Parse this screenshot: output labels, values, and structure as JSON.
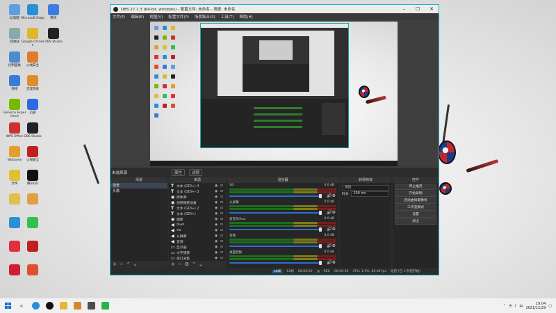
{
  "desktop": {
    "icons": [
      {
        "label": "此电脑",
        "color": "#5aa0e0"
      },
      {
        "label": "Microsoft Edge",
        "color": "#2b8fd6"
      },
      {
        "label": "腾讯",
        "color": "#3e7be0"
      },
      {
        "label": "回收站",
        "color": "#8aa"
      },
      {
        "label": "Google Chrome",
        "color": "#e0b62b"
      },
      {
        "label": "OBS Studio",
        "color": "#222"
      },
      {
        "label": "控制面板",
        "color": "#4a8ed0"
      },
      {
        "label": "火绒安全",
        "color": "#e07b2b"
      },
      {
        "label": "",
        "color": "#fff"
      },
      {
        "label": "网络",
        "color": "#3a7bd5"
      },
      {
        "label": "百度网盘",
        "color": "#e08c2b"
      },
      {
        "label": "",
        "color": "#fff"
      },
      {
        "label": "GeForce Experience",
        "color": "#76b900"
      },
      {
        "label": "迅雷",
        "color": "#2b6be0"
      },
      {
        "label": "",
        "color": "#fff"
      },
      {
        "label": "WPS Office",
        "color": "#d03030"
      },
      {
        "label": "OBS Studio",
        "color": "#222"
      },
      {
        "label": "",
        "color": "#fff"
      },
      {
        "label": "WeGame",
        "color": "#e0a02b"
      },
      {
        "label": "火绒安全",
        "color": "#c02020"
      },
      {
        "label": "",
        "color": "#fff"
      },
      {
        "label": "文件",
        "color": "#e0c030"
      },
      {
        "label": "腾讯QQ",
        "color": "#111"
      },
      {
        "label": "",
        "color": "#fff"
      },
      {
        "label": "",
        "color": "#e0c04a"
      },
      {
        "label": "",
        "color": "#e0a040"
      },
      {
        "label": "",
        "color": "#fff"
      },
      {
        "label": "",
        "color": "#2b8fd6"
      },
      {
        "label": "",
        "color": "#32c050"
      },
      {
        "label": "",
        "color": "#fff"
      },
      {
        "label": "",
        "color": "#e03040"
      },
      {
        "label": "",
        "color": "#c02020"
      },
      {
        "label": "",
        "color": "#fff"
      },
      {
        "label": "",
        "color": "#d02030"
      },
      {
        "label": "",
        "color": "#e05030"
      }
    ]
  },
  "obs": {
    "title": "OBS 27.1.3 (64-bit, windows) - 配置文件: 未命名 - 场景: 未命名",
    "menu": [
      "文件(F)",
      "编辑(E)",
      "视图(V)",
      "配置文件(P)",
      "场景集合(S)",
      "工具(T)",
      "帮助(H)"
    ],
    "current_scene": "未选择源",
    "scene_buttons": [
      "属性",
      "滤镜"
    ],
    "docks": {
      "scenes": {
        "title": "场景",
        "items": [
          "场景",
          "头像"
        ]
      },
      "sources": {
        "title": "来源",
        "items": [
          {
            "type": "T",
            "name": "文本 (GDI+) 4"
          },
          {
            "type": "T",
            "name": "文本 (GDI+) 3"
          },
          {
            "type": "◉",
            "name": "媒体源"
          },
          {
            "type": "◉",
            "name": "视频捕获设备"
          },
          {
            "type": "T",
            "name": "文本 (GDI+) 2"
          },
          {
            "type": "T",
            "name": "文本 (GDI+)"
          },
          {
            "type": "◉",
            "name": "图像"
          },
          {
            "type": "◀",
            "name": "BGM"
          },
          {
            "type": "◀",
            "name": "VB"
          },
          {
            "type": "◀",
            "name": "从屏幕"
          },
          {
            "type": "◀",
            "name": "音频"
          },
          {
            "type": "▭",
            "name": "显示器"
          },
          {
            "type": "▭",
            "name": "文字捕获"
          },
          {
            "type": "▭",
            "name": "窗口采集"
          }
        ]
      },
      "mixer": {
        "title": "混音器",
        "channels": [
          {
            "name": "VB",
            "db": "0.0 dB"
          },
          {
            "name": "从屏幕",
            "db": "0.0 dB"
          },
          {
            "name": "麦克风/Aux",
            "db": "0.0 dB"
          },
          {
            "name": "音频",
            "db": "0.0 dB"
          },
          {
            "name": "桌面音频",
            "db": "0.0 dB"
          }
        ]
      },
      "transitions": {
        "title": "转场特效",
        "type": "淡出",
        "duration_label": "时长",
        "duration": "300 ms"
      },
      "controls": {
        "title": "控件",
        "buttons": [
          "停止推流",
          "开始录制",
          "启动虚拟摄像机",
          "工作室模式",
          "设置",
          "退出"
        ]
      }
    },
    "status": {
      "live_label": "LIVE",
      "frames": "12帧",
      "live_time": "00:00:00",
      "rec_label": "REC",
      "rec_time": "00:00:00",
      "cpu": "CPU: 1.9%, 60.00 fps",
      "extra": "延迟 (已 1 秒后开始)"
    }
  },
  "taskbar": {
    "apps": [
      "windows-start",
      "search",
      "edge",
      "obs",
      "explorer",
      "wegame",
      "settings",
      "wechat"
    ],
    "time": "19:04",
    "date": "2021/12/29"
  }
}
